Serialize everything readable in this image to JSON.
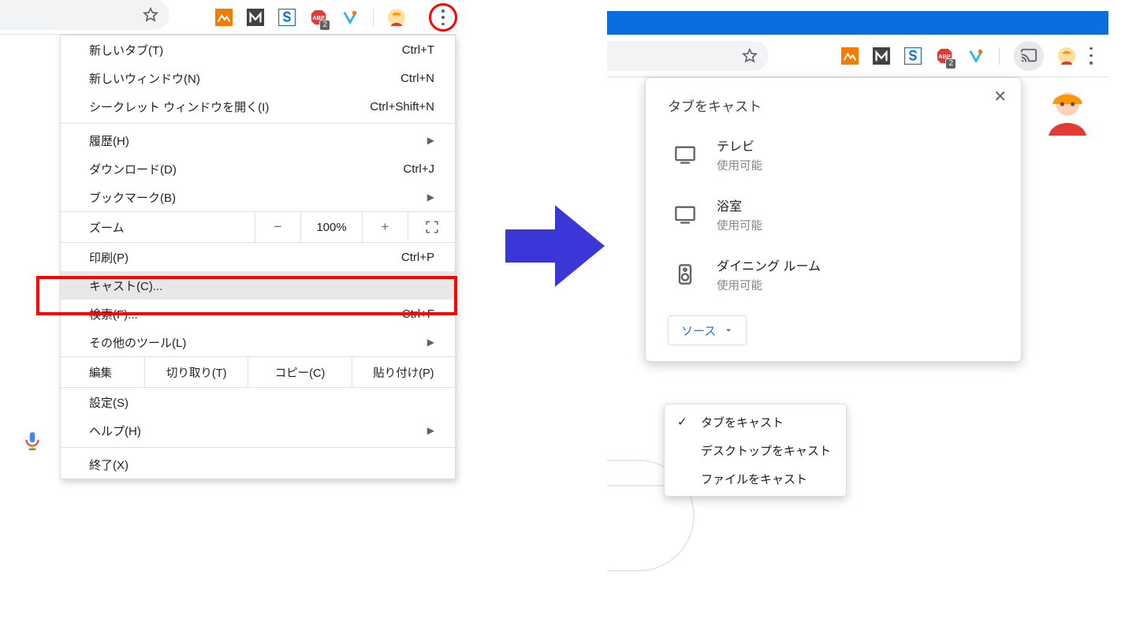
{
  "left": {
    "menu": {
      "new_tab": {
        "label": "新しいタブ(T)",
        "shortcut": "Ctrl+T"
      },
      "new_window": {
        "label": "新しいウィンドウ(N)",
        "shortcut": "Ctrl+N"
      },
      "incognito": {
        "label": "シークレット ウィンドウを開く(I)",
        "shortcut": "Ctrl+Shift+N"
      },
      "history": {
        "label": "履歴(H)"
      },
      "downloads": {
        "label": "ダウンロード(D)",
        "shortcut": "Ctrl+J"
      },
      "bookmarks": {
        "label": "ブックマーク(B)"
      },
      "zoom": {
        "label": "ズーム",
        "minus": "−",
        "value": "100%",
        "plus": "+"
      },
      "print": {
        "label": "印刷(P)",
        "shortcut": "Ctrl+P"
      },
      "cast": {
        "label": "キャスト(C)..."
      },
      "find": {
        "label": "検索(F)...",
        "shortcut": "Ctrl+F"
      },
      "more_tools": {
        "label": "その他のツール(L)"
      },
      "edit": {
        "label": "編集",
        "cut": "切り取り(T)",
        "copy": "コピー(C)",
        "paste": "貼り付け(P)"
      },
      "settings": {
        "label": "設定(S)"
      },
      "help": {
        "label": "ヘルプ(H)"
      },
      "exit": {
        "label": "終了(X)"
      }
    },
    "badge": "2"
  },
  "right": {
    "badge": "2",
    "cast": {
      "title": "タブをキャスト",
      "devices": [
        {
          "name": "テレビ",
          "status": "使用可能",
          "icon": "tv"
        },
        {
          "name": "浴室",
          "status": "使用可能",
          "icon": "tv"
        },
        {
          "name": "ダイニング ルーム",
          "status": "使用可能",
          "icon": "speaker"
        }
      ],
      "source_label": "ソース",
      "source_menu": [
        {
          "label": "タブをキャスト",
          "checked": true
        },
        {
          "label": "デスクトップをキャスト",
          "checked": false
        },
        {
          "label": "ファイルをキャスト",
          "checked": false
        }
      ]
    }
  }
}
